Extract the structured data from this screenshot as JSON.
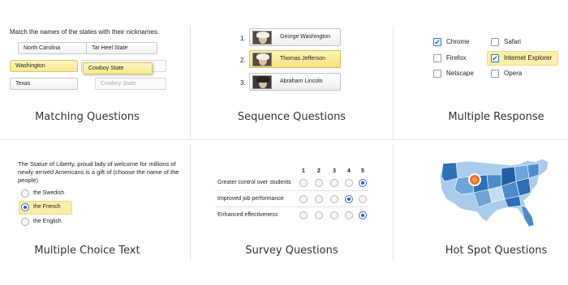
{
  "captions": {
    "matching": "Matching Questions",
    "sequence": "Sequence Questions",
    "multiple_response": "Multiple Response",
    "multiple_choice_text": "Multiple Choice Text",
    "survey": "Survey Questions",
    "hotspot": "Hot Spot Questions"
  },
  "matching": {
    "instruction": "Match the names of the states with their nicknames:",
    "row1_left": "North Carolina",
    "row1_right": "Tar Heel State",
    "row2_left": "Washington",
    "row2_drag": "Cowboy State",
    "row3_left": "Texas",
    "row3_ghost": "Cowboy State"
  },
  "sequence": {
    "items": [
      {
        "num": "1.",
        "label": "George Washington"
      },
      {
        "num": "2.",
        "label": "Thomas Jefferson"
      },
      {
        "num": "3.",
        "label": "Abraham Lincoln"
      }
    ]
  },
  "multiple_response": {
    "options": [
      {
        "label": "Chrome",
        "checked": true
      },
      {
        "label": "Firefox",
        "checked": false
      },
      {
        "label": "Netscape",
        "checked": false
      },
      {
        "label": "Safari",
        "checked": false
      },
      {
        "label": "Internet Explorer",
        "checked": true
      },
      {
        "label": "Opera",
        "checked": false
      }
    ]
  },
  "multiple_choice_text": {
    "question": "The Statue of Liberty, proud lady of welcome for millions of newly arrived Americans is a gift of (choose the name of the people)",
    "options": [
      {
        "label": "the Swedish",
        "selected": false
      },
      {
        "label": "the French",
        "selected": true
      },
      {
        "label": "the English",
        "selected": false
      }
    ]
  },
  "survey": {
    "scale": [
      "1",
      "2",
      "3",
      "4",
      "5"
    ],
    "rows": [
      {
        "label": "Greater control over students",
        "selected": "5"
      },
      {
        "label": "Improved job performance",
        "selected": "4"
      },
      {
        "label": "Enhanced effectiveness",
        "selected": "5"
      }
    ]
  },
  "colors": {
    "highlight": "#fbeea8",
    "accent": "#1f5fc8",
    "marker": "#e8742a",
    "map_dark": "#2f6fb5",
    "map_light": "#a9cbec"
  }
}
